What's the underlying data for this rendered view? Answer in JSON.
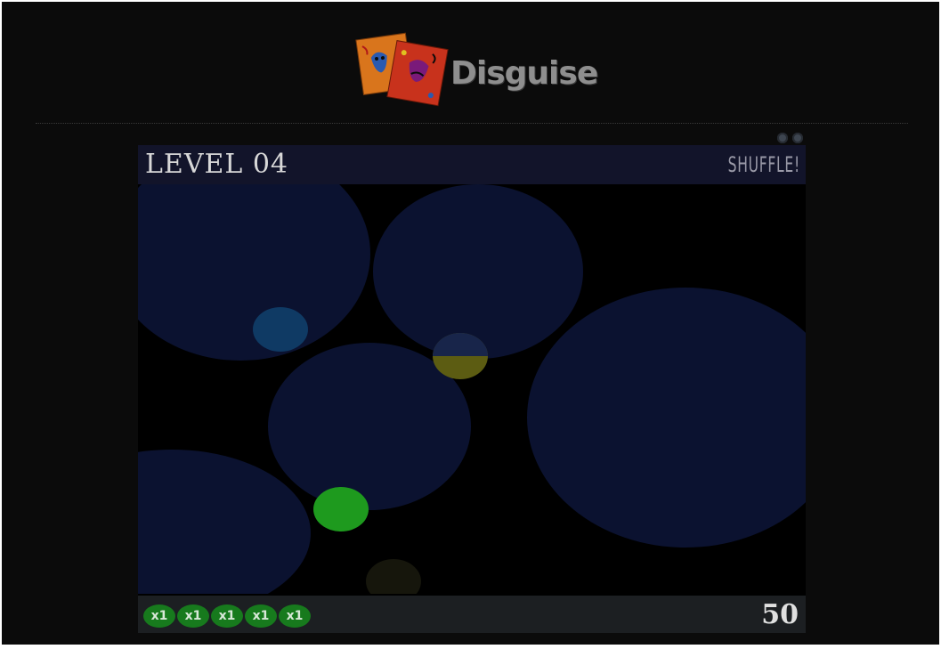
{
  "app": {
    "name": "Disguise",
    "logo_icon": "theater-masks-cards-icon"
  },
  "window_controls": [
    {
      "name": "minimize-dot-icon"
    },
    {
      "name": "close-dot-icon"
    }
  ],
  "game": {
    "level_title": "LEVEL 04",
    "shuffle_label": "SHUFFLE!",
    "score": "50",
    "multipliers": [
      {
        "label": "x1"
      },
      {
        "label": "x1"
      },
      {
        "label": "x1"
      },
      {
        "label": "x1"
      },
      {
        "label": "x1"
      }
    ]
  },
  "colors": {
    "page_background": "#0b0b0b",
    "header_bar": "#12142a",
    "footer_bar": "#1c1f22",
    "zone_fill": "#0b1230",
    "ball_blue": "#0f3a64",
    "ball_yellow": "#6a6a14",
    "ball_green": "#1e9a1e",
    "ball_olive": "#16160c",
    "token_green": "#177a1d"
  }
}
